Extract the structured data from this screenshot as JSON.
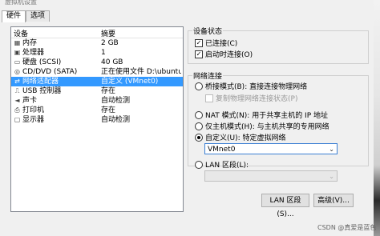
{
  "window": {
    "title": "虚拟机设置"
  },
  "tabs": [
    {
      "label": "硬件"
    },
    {
      "label": "选项"
    }
  ],
  "device_list": {
    "headers": {
      "device": "设备",
      "summary": "摘要"
    },
    "items": [
      {
        "icon": "memory-icon",
        "glyph": "▦",
        "name": "内存",
        "summary": "2 GB"
      },
      {
        "icon": "cpu-icon",
        "glyph": "▣",
        "name": "处理器",
        "summary": "1"
      },
      {
        "icon": "disk-icon",
        "glyph": "▭",
        "name": "硬盘 (SCSI)",
        "summary": "40 GB"
      },
      {
        "icon": "cd-icon",
        "glyph": "◎",
        "name": "CD/DVD (SATA)",
        "summary": "正在使用文件 D:\\ubuntu\\ubu..."
      },
      {
        "icon": "network-icon",
        "glyph": "⇄",
        "name": "网络适配器",
        "summary": "自定义 (VMnet0)",
        "selected": true
      },
      {
        "icon": "usb-icon",
        "glyph": "⎍",
        "name": "USB 控制器",
        "summary": "存在"
      },
      {
        "icon": "speaker-icon",
        "glyph": "◄",
        "name": "声卡",
        "summary": "自动检测"
      },
      {
        "icon": "printer-icon",
        "glyph": "⎙",
        "name": "打印机",
        "summary": "存在"
      },
      {
        "icon": "monitor-icon",
        "glyph": "▢",
        "name": "显示器",
        "summary": "自动检测"
      }
    ]
  },
  "device_status": {
    "title": "设备状态",
    "connected": {
      "label": "已连接(C)",
      "checked": true
    },
    "connect_at_power_on": {
      "label": "启动时连接(O)",
      "checked": true
    }
  },
  "network_connection": {
    "title": "网络连接",
    "bridged": {
      "label": "桥接模式(B): 直接连接物理网络",
      "selected": false
    },
    "replicate_state": {
      "label": "复制物理网络连接状态(P)",
      "checked": false,
      "disabled": true
    },
    "nat": {
      "label": "NAT 模式(N): 用于共享主机的 IP 地址",
      "selected": false
    },
    "host_only": {
      "label": "仅主机模式(H): 与主机共享的专用网络",
      "selected": false
    },
    "custom": {
      "label": "自定义(U): 特定虚拟网络",
      "selected": true
    },
    "custom_value": "VMnet0",
    "lan_segment": {
      "label": "LAN 区段(L):",
      "selected": false
    },
    "lan_value": ""
  },
  "buttons": {
    "lan_segments": "LAN 区段(S)...",
    "advanced": "高级(V)..."
  },
  "watermark": "CSDN @真爱是蓝色"
}
